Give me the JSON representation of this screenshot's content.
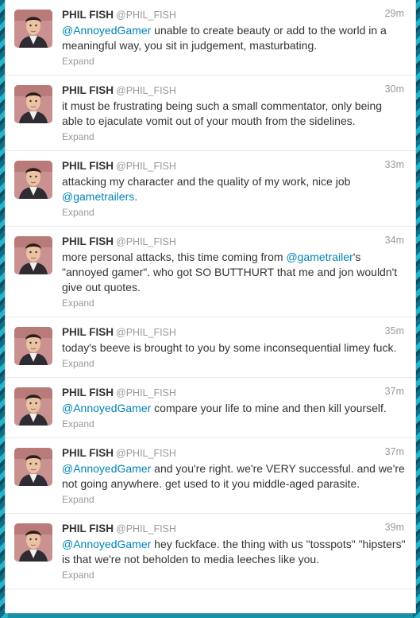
{
  "tweets": [
    {
      "name": "PHIL FISH",
      "handle": "@PHIL_FISH",
      "time": "29m",
      "segments": [
        {
          "t": "@AnnoyedGamer",
          "m": true
        },
        {
          "t": " unable to create beauty or add to the world in a meaningful way, you sit in judgement, masturbating.",
          "m": false
        }
      ],
      "expand": "Expand"
    },
    {
      "name": "PHIL FISH",
      "handle": "@PHIL_FISH",
      "time": "30m",
      "segments": [
        {
          "t": "it must be frustrating being such a small commentator, only being able to ejaculate vomit out of your mouth from the sidelines.",
          "m": false
        }
      ],
      "expand": "Expand"
    },
    {
      "name": "PHIL FISH",
      "handle": "@PHIL_FISH",
      "time": "33m",
      "segments": [
        {
          "t": "attacking my character and the quality of my work, nice job ",
          "m": false
        },
        {
          "t": "@gametrailers",
          "m": true
        },
        {
          "t": ".",
          "m": false
        }
      ],
      "expand": "Expand"
    },
    {
      "name": "PHIL FISH",
      "handle": "@PHIL_FISH",
      "time": "34m",
      "segments": [
        {
          "t": "more personal attacks, this time coming from ",
          "m": false
        },
        {
          "t": "@gametrailer",
          "m": true
        },
        {
          "t": "'s \"annoyed gamer\". who got SO BUTTHURT that me and jon wouldn't give out quotes.",
          "m": false
        }
      ],
      "expand": "Expand"
    },
    {
      "name": "PHIL FISH",
      "handle": "@PHIL_FISH",
      "time": "35m",
      "segments": [
        {
          "t": "today's beeve is brought to you by some inconsequential limey fuck.",
          "m": false
        }
      ],
      "expand": "Expand"
    },
    {
      "name": "PHIL FISH",
      "handle": "@PHIL_FISH",
      "time": "37m",
      "segments": [
        {
          "t": "@AnnoyedGamer",
          "m": true
        },
        {
          "t": " compare your life to mine and then kill yourself.",
          "m": false
        }
      ],
      "expand": "Expand"
    },
    {
      "name": "PHIL FISH",
      "handle": "@PHIL_FISH",
      "time": "37m",
      "segments": [
        {
          "t": "@AnnoyedGamer",
          "m": true
        },
        {
          "t": " and you're right. we're VERY successful. and we're not going anywhere. get used to it you middle-aged parasite.",
          "m": false
        }
      ],
      "expand": "Expand"
    },
    {
      "name": "PHIL FISH",
      "handle": "@PHIL_FISH",
      "time": "39m",
      "segments": [
        {
          "t": "@AnnoyedGamer",
          "m": true
        },
        {
          "t": " hey fuckface. the thing with us \"tosspots\" \"hipsters\" is that we're not beholden to media leeches like you.",
          "m": false
        }
      ],
      "expand": "Expand"
    }
  ],
  "colors": {
    "mention": "#0084b4",
    "meta": "#999999",
    "text": "#333333",
    "background_pattern": "#1b8fa6"
  },
  "icons": {
    "avatar": "profile-photo"
  }
}
